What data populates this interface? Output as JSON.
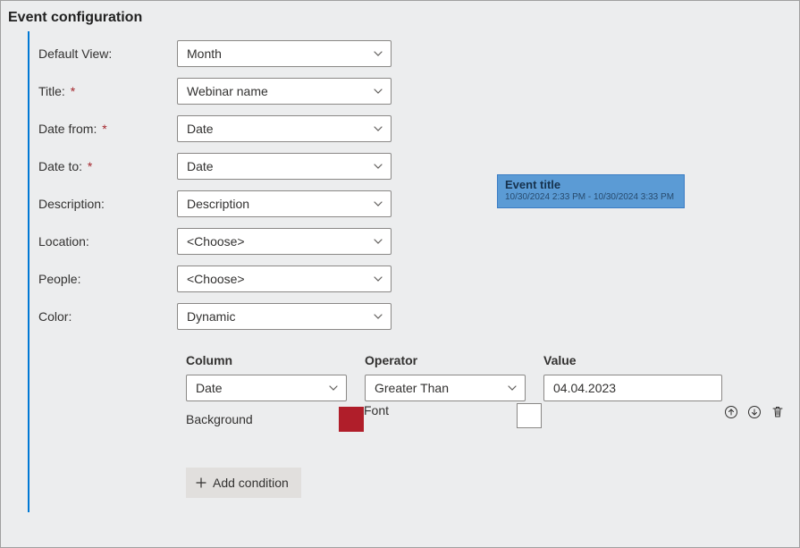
{
  "heading": "Event configuration",
  "fields": {
    "default_view": {
      "label": "Default View:",
      "value": "Month",
      "required": false
    },
    "title": {
      "label": "Title:",
      "value": "Webinar name",
      "required": true
    },
    "date_from": {
      "label": "Date from:",
      "value": "Date",
      "required": true
    },
    "date_to": {
      "label": "Date to:",
      "value": "Date",
      "required": true
    },
    "description": {
      "label": "Description:",
      "value": "Description",
      "required": false
    },
    "location": {
      "label": "Location:",
      "value": "<Choose>",
      "required": false
    },
    "people": {
      "label": "People:",
      "value": "<Choose>",
      "required": false
    },
    "color": {
      "label": "Color:",
      "value": "Dynamic",
      "required": false
    }
  },
  "required_mark": "*",
  "preview": {
    "title": "Event title",
    "time": "10/30/2024 2:33 PM - 10/30/2024 3:33 PM"
  },
  "conditions": {
    "headers": {
      "column": "Column",
      "operator": "Operator",
      "value": "Value"
    },
    "row": {
      "column": "Date",
      "operator": "Greater Than",
      "value": "04.04.2023",
      "background_label": "Background",
      "background_color": "#b01e2a",
      "font_label": "Font",
      "font_color": "#ffffff"
    },
    "add_label": "Add condition"
  }
}
